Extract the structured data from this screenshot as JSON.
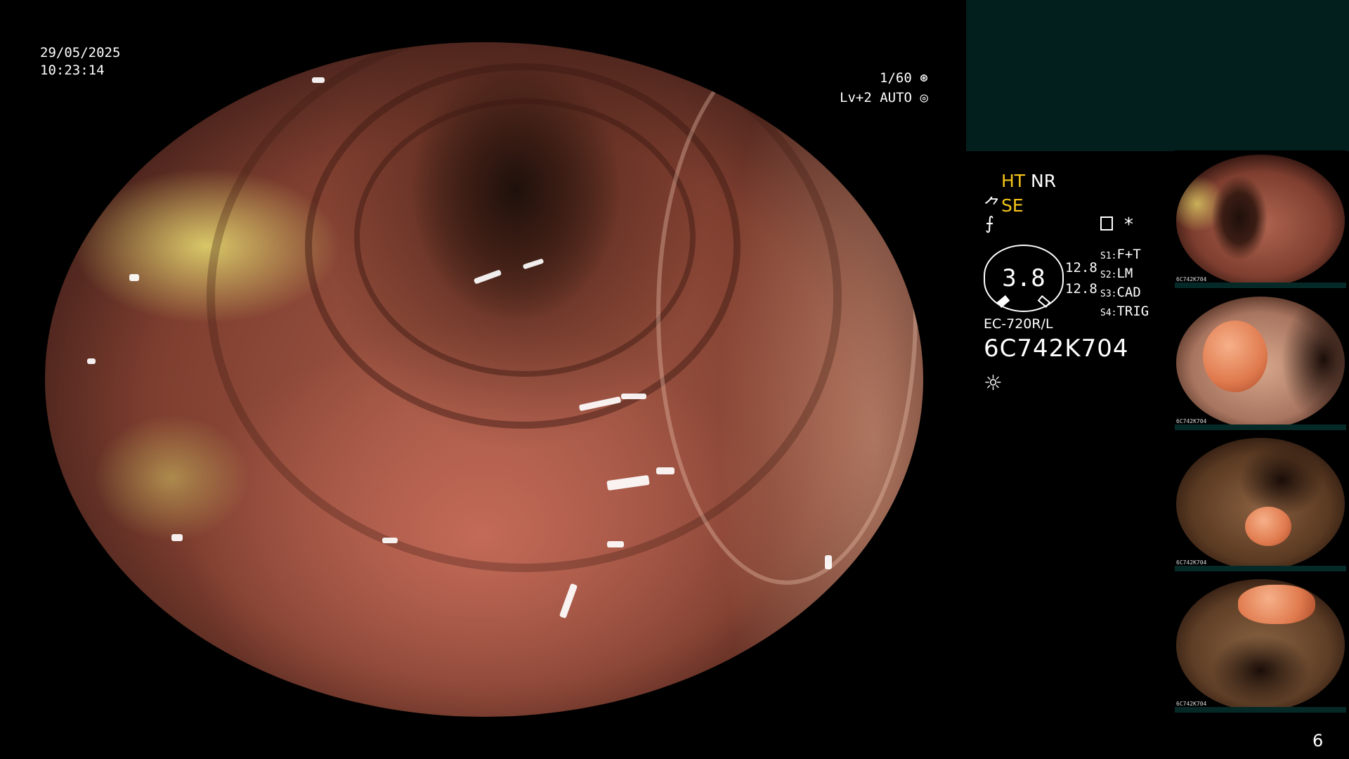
{
  "overlay": {
    "date": "29/05/2025",
    "time": "10:23:14",
    "shutter": "1/60",
    "level": "Lv+2",
    "exposure_mode": "AUTO"
  },
  "settings": {
    "ht": "HT",
    "nr": "NR",
    "se": "SE",
    "gauge_value": "3.8",
    "gauge_left_1": "12.8",
    "gauge_left_2": "12.8",
    "model": "EC-720R/L",
    "serial": "6C742K704",
    "asterisk": "*",
    "switches": [
      {
        "key": "S1:",
        "value": "F+T"
      },
      {
        "key": "S2:",
        "value": "LM"
      },
      {
        "key": "S3:",
        "value": "CAD"
      },
      {
        "key": "S4:",
        "value": "TRIG"
      }
    ]
  },
  "thumbnails": [
    {
      "tag": "6C742K704"
    },
    {
      "tag": "6C742K704"
    },
    {
      "tag": "6C742K704"
    },
    {
      "tag": "6C742K704"
    }
  ],
  "page_number": "6",
  "icons": {
    "shutter": "shutter-icon",
    "exposure": "exposure-icon",
    "se": "scope-icon",
    "enhance": "enhance-icon",
    "settings_panel": "panel-icon",
    "light": "light-icon"
  }
}
